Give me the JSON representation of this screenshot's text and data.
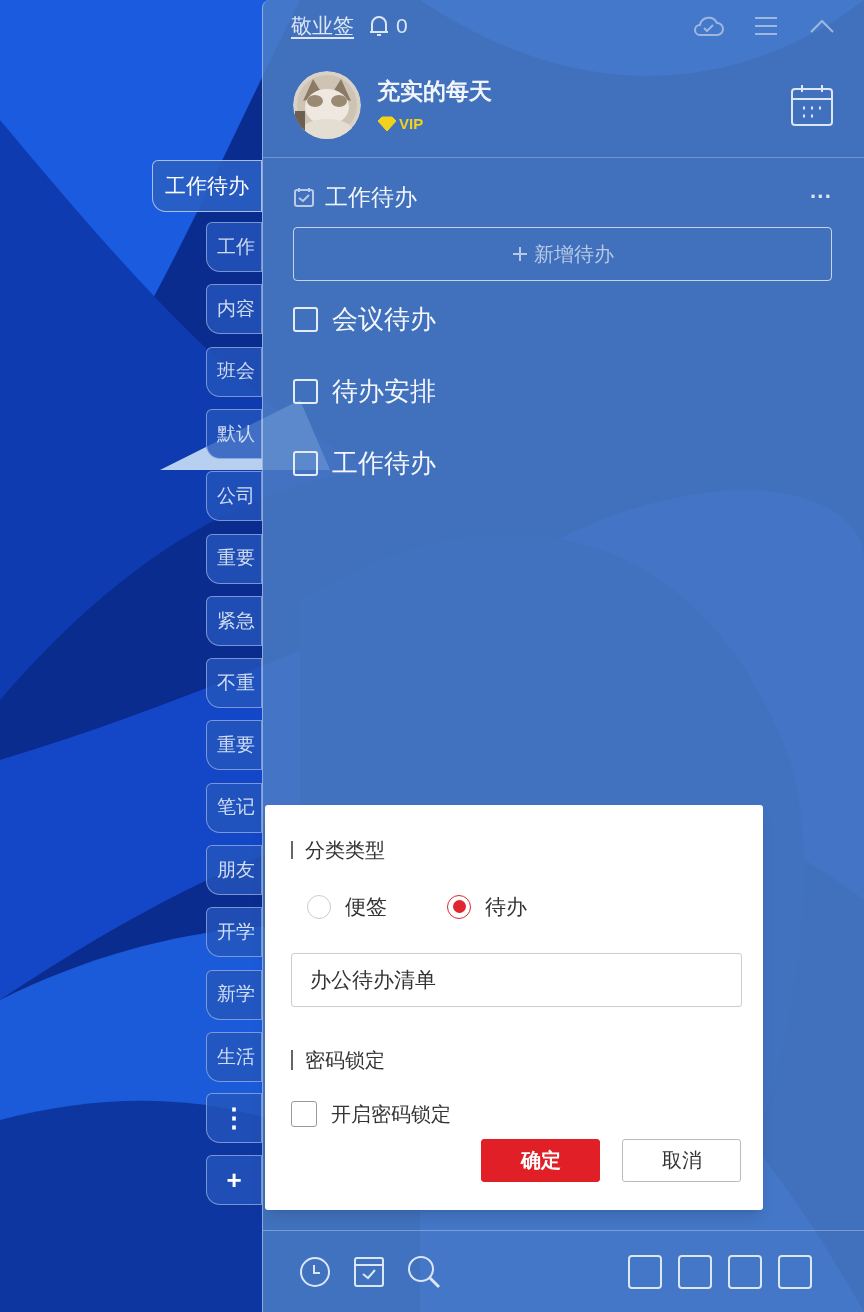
{
  "app": {
    "title": "敬业签",
    "notification_count": "0"
  },
  "user": {
    "name": "充实的每天",
    "badge": "VIP"
  },
  "categories": [
    {
      "label": "工作待办",
      "selected": true
    },
    {
      "label": "工作",
      "selected": false
    },
    {
      "label": "内容",
      "selected": false
    },
    {
      "label": "班会",
      "selected": false
    },
    {
      "label": "默认",
      "selected": false
    },
    {
      "label": "公司",
      "selected": false
    },
    {
      "label": "重要",
      "selected": false
    },
    {
      "label": "紧急",
      "selected": false
    },
    {
      "label": "不重",
      "selected": false
    },
    {
      "label": "重要",
      "selected": false
    },
    {
      "label": "笔记",
      "selected": false
    },
    {
      "label": "朋友",
      "selected": false
    },
    {
      "label": "开学",
      "selected": false
    },
    {
      "label": "新学",
      "selected": false
    },
    {
      "label": "生活",
      "selected": false
    }
  ],
  "category_actions": [
    "⋮",
    "+"
  ],
  "list": {
    "title": "工作待办",
    "more": "···",
    "add_button": "新增待办",
    "items": [
      {
        "label": "会议待办",
        "checked": false
      },
      {
        "label": "待办安排",
        "checked": false
      },
      {
        "label": "工作待办",
        "checked": false
      }
    ]
  },
  "dialog": {
    "type_title": "分类类型",
    "types": [
      {
        "label": "便签",
        "selected": false
      },
      {
        "label": "待办",
        "selected": true
      }
    ],
    "name_value": "办公待办清单",
    "lock_title": "密码锁定",
    "lock_option": {
      "label": "开启密码锁定",
      "checked": false
    },
    "buttons": [
      {
        "label": "确定",
        "kind": "primary"
      },
      {
        "label": "取消",
        "kind": "secondary"
      }
    ]
  }
}
